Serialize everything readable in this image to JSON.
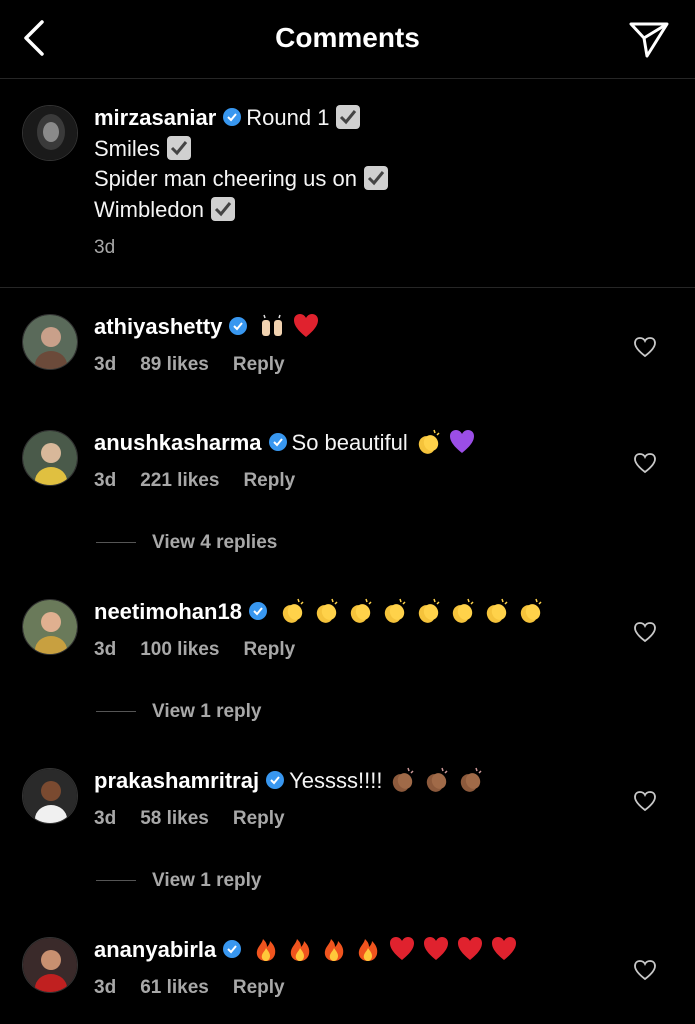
{
  "header": {
    "title": "Comments",
    "back_icon": "chevron-left-icon",
    "share_icon": "paper-plane-icon"
  },
  "caption": {
    "username": "mirzasaniar",
    "lines": [
      "Round 1",
      "Smiles",
      "Spider man cheering us on",
      "Wimbledon"
    ],
    "time": "3d"
  },
  "comments": [
    {
      "username": "athiyashetty",
      "text": "",
      "emojis": [
        "raised-hands",
        "red-heart"
      ],
      "time": "3d",
      "likes": "89 likes",
      "reply": "Reply",
      "view_replies": ""
    },
    {
      "username": "anushkasharma",
      "text": "So beautiful",
      "emojis": [
        "clap",
        "purple-heart"
      ],
      "time": "3d",
      "likes": "221 likes",
      "reply": "Reply",
      "view_replies": "View 4 replies"
    },
    {
      "username": "neetimohan18",
      "text": "",
      "emojis": [
        "clap",
        "clap",
        "clap",
        "clap",
        "clap",
        "clap",
        "clap",
        "clap"
      ],
      "time": "3d",
      "likes": "100 likes",
      "reply": "Reply",
      "view_replies": "View 1 reply"
    },
    {
      "username": "prakashamritraj",
      "text": "Yessss!!!!",
      "emojis": [
        "clap-dark",
        "clap-dark",
        "clap-dark"
      ],
      "time": "3d",
      "likes": "58 likes",
      "reply": "Reply",
      "view_replies": "View 1 reply"
    },
    {
      "username": "ananyabirla",
      "text": "",
      "emojis": [
        "fire",
        "fire",
        "fire",
        "fire",
        "red-heart",
        "red-heart",
        "red-heart",
        "red-heart"
      ],
      "time": "3d",
      "likes": "61 likes",
      "reply": "Reply",
      "view_replies": ""
    }
  ],
  "colors": {
    "background": "#000000",
    "verified": "#3897f0",
    "muted": "#a8a8a8"
  }
}
